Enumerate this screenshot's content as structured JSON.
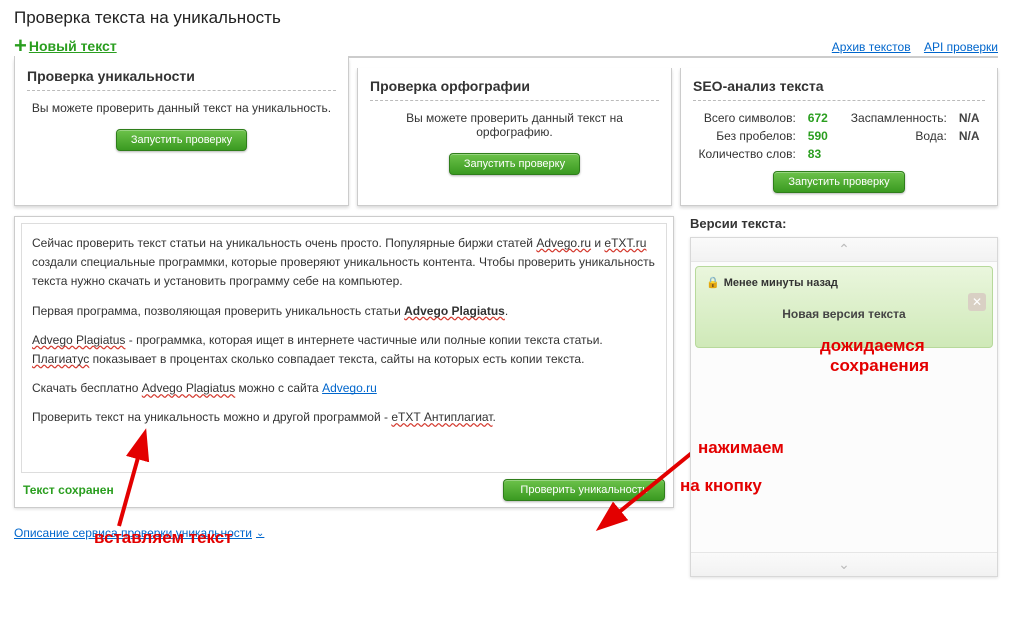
{
  "page": {
    "title": "Проверка текста на уникальность"
  },
  "toolbar": {
    "new_text": "Новый текст",
    "archive": "Архив текстов",
    "api": "API проверки"
  },
  "tabs": {
    "uniqueness": {
      "title": "Проверка уникальности",
      "desc": "Вы можете проверить данный текст на уникальность.",
      "button": "Запустить проверку"
    },
    "spelling": {
      "title": "Проверка орфографии",
      "desc": "Вы можете проверить данный текст на орфографию.",
      "button": "Запустить проверку"
    },
    "seo": {
      "title": "SEO-анализ текста",
      "total_label": "Всего символов:",
      "total_value": "672",
      "nospaces_label": "Без пробелов:",
      "nospaces_value": "590",
      "words_label": "Количество слов:",
      "words_value": "83",
      "spam_label": "Заспамленность:",
      "spam_value": "N/A",
      "water_label": "Вода:",
      "water_value": "N/A",
      "button": "Запустить проверку"
    }
  },
  "editor": {
    "p1_a": "Сейчас проверить текст статьи на уникальность очень просто.  Популярные биржи статей ",
    "p1_adv": "Advego.ru",
    "p1_b": " и ",
    "p1_etxt": "eTXT.ru",
    "p1_c": " создали специальные программки, которые проверяют уникальность контента. Чтобы проверить уникальность текста нужно скачать и установить программу себе на компьютер.",
    "p2_a": "Первая программа, позволяющая проверить уникальность статьи ",
    "p2_b": "Advego Plagiatus",
    "p2_c": ".",
    "p3_a": "Advego Plagiatus",
    "p3_b": " - программка, которая ищет  в интернете частичные или полные копии текста статьи. ",
    "p3_c": "Плагиатус",
    "p3_d": " показывает в процентах сколько совпадает текста, сайты на которых есть копии текста.",
    "p4_a": "Скачать бесплатно ",
    "p4_b": "Advego Plagiatus",
    "p4_c": " можно с сайта ",
    "p4_link": "Advego.ru",
    "p5_a": "Проверить текст на уникальность можно и другой программой - ",
    "p5_b": "eTXT Антиплагиат",
    "p5_c": ".",
    "saved": "Текст сохранен",
    "check_button": "Проверить уникальность",
    "desc_link": "Описание сервиса проверки уникальности"
  },
  "versions": {
    "title": "Версии текста:",
    "item_time": "Менее минуты назад",
    "item_label": "Новая версия текста"
  },
  "annotations": {
    "insert": "вставляем текст",
    "press1": "нажимаем",
    "press2": "на кнопку",
    "wait1": "дожидаемся",
    "wait2": "сохранения"
  }
}
